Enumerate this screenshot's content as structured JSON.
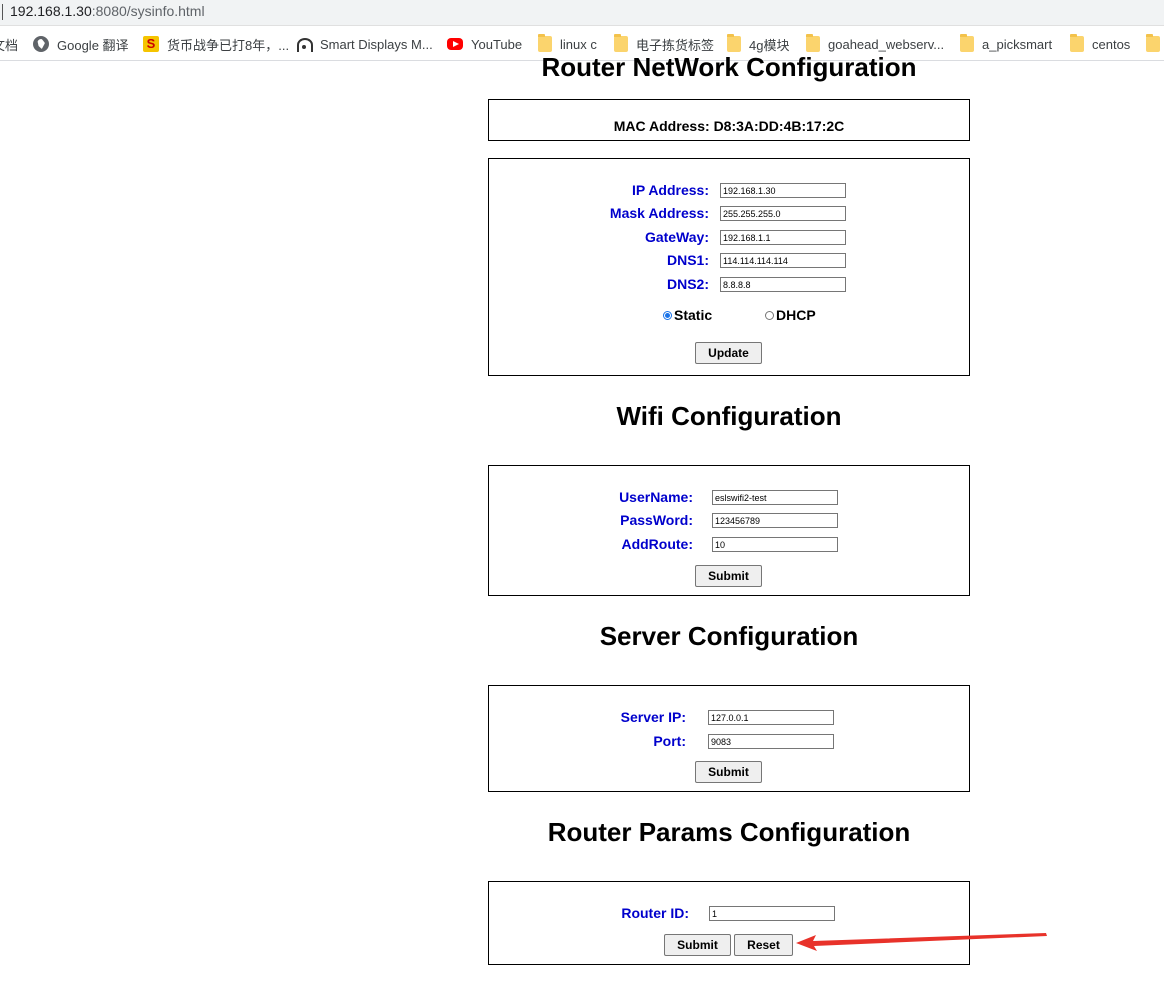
{
  "browser": {
    "url_host": "192.168.1.30",
    "url_rest": ":8080/sysinfo.html"
  },
  "bookmarks": [
    {
      "label": "文档",
      "icon": "none"
    },
    {
      "label": "Google 翻译",
      "icon": "globe-icon"
    },
    {
      "label": "货币战争已打8年，...",
      "icon": "s-logo-icon"
    },
    {
      "label": "Smart Displays M...",
      "icon": "wifi-icon"
    },
    {
      "label": "YouTube",
      "icon": "youtube-icon"
    },
    {
      "label": "linux c",
      "icon": "folder-icon"
    },
    {
      "label": "电子拣货标签",
      "icon": "folder-icon"
    },
    {
      "label": "4g模块",
      "icon": "folder-icon"
    },
    {
      "label": "goahead_webserv...",
      "icon": "folder-icon"
    },
    {
      "label": "a_picksmart",
      "icon": "folder-icon"
    },
    {
      "label": "centos",
      "icon": "folder-icon"
    }
  ],
  "router_network": {
    "title": "Router NetWork Configuration",
    "mac_label": "MAC Address:",
    "mac_value": "D8:3A:DD:4B:17:2C",
    "fields": [
      {
        "label": "IP Address:",
        "value": "192.168.1.30"
      },
      {
        "label": "Mask Address:",
        "value": "255.255.255.0"
      },
      {
        "label": "GateWay:",
        "value": "192.168.1.1"
      },
      {
        "label": "DNS1:",
        "value": "114.114.114.114"
      },
      {
        "label": "DNS2:",
        "value": "8.8.8.8"
      }
    ],
    "radio_static": "Static",
    "radio_dhcp": "DHCP",
    "selected_mode": "Static",
    "update_button": "Update"
  },
  "wifi": {
    "title": "Wifi Configuration",
    "fields": [
      {
        "label": "UserName:",
        "value": "eslswifi2-test"
      },
      {
        "label": "PassWord:",
        "value": "123456789"
      },
      {
        "label": "AddRoute:",
        "value": "10"
      }
    ],
    "submit_button": "Submit"
  },
  "server": {
    "title": "Server Configuration",
    "fields": [
      {
        "label": "Server IP:",
        "value": "127.0.0.1"
      },
      {
        "label": "Port:",
        "value": "9083"
      }
    ],
    "submit_button": "Submit"
  },
  "router_params": {
    "title": "Router Params Configuration",
    "fields": [
      {
        "label": "Router ID:",
        "value": "1"
      }
    ],
    "submit_button": "Submit",
    "reset_button": "Reset"
  },
  "colors": {
    "label_blue": "#0000cc",
    "annotation_arrow": "#e8322a"
  }
}
